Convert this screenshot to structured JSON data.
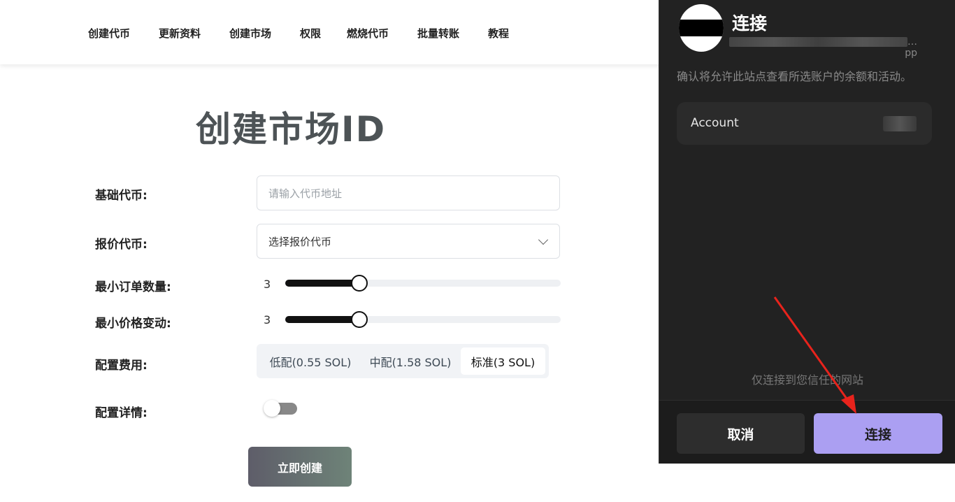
{
  "nav": {
    "items": [
      "创建代币",
      "更新资料",
      "创建市场",
      "权限",
      "燃烧代币",
      "批量转账",
      "教程"
    ]
  },
  "main": {
    "title": "创建市场ID",
    "base_token": {
      "label": "基础代币:",
      "placeholder": "请输入代币地址"
    },
    "quote_token": {
      "label": "报价代币:",
      "value": "选择报价代币"
    },
    "min_order": {
      "label": "最小订单数量:",
      "value": "3",
      "fraction": 0.27
    },
    "min_price": {
      "label": "最小价格变动:",
      "value": "3",
      "fraction": 0.27
    },
    "fee": {
      "label": "配置费用:",
      "options": [
        "低配(0.55 SOL)",
        "中配(1.58 SOL)",
        "标准(3 SOL)"
      ],
      "selected": "标准(3 SOL)"
    },
    "details": {
      "label": "配置详情:",
      "enabled": false
    },
    "create_button": "立即创建"
  },
  "wallet": {
    "title": "连接",
    "domain_suffix": "…pp",
    "description": "确认将允许此站点查看所选账户的余额和活动。",
    "account_label": "Account",
    "trust_note": "仅连接到您信任的网站",
    "cancel": "取消",
    "connect": "连接"
  },
  "colors": {
    "accent_connect": "#ab9ff2",
    "wallet_bg": "#222222",
    "arrow": "#e8231c"
  }
}
